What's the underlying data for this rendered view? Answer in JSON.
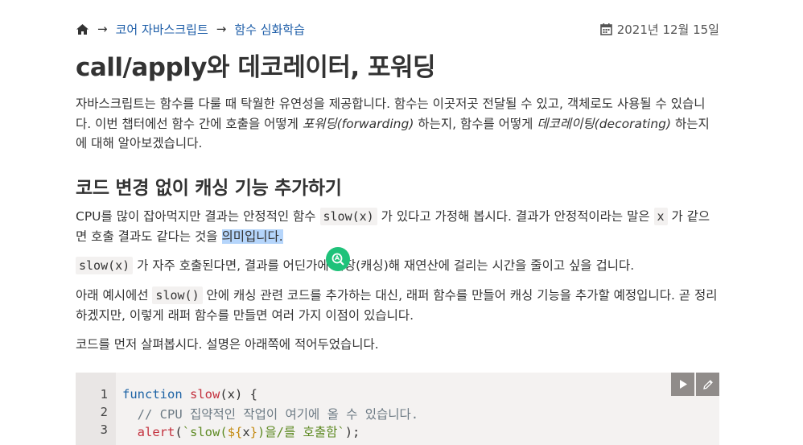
{
  "breadcrumb": {
    "items": [
      "코어 자바스크립트",
      "함수 심화학습"
    ],
    "separator": "→"
  },
  "date": "2021년 12월 15일",
  "title": "call/apply와 데코레이터, 포워딩",
  "intro": {
    "a": "자바스크립트는 함수를 다룰 때 탁월한 유연성을 제공합니다. 함수는 이곳저곳 전달될 수 있고, 객체로도 사용될 수 있습니다. 이번 챕터에선 함수 간에 호출을 어떻게 ",
    "em1": "포워딩(forwarding)",
    "b": " 하는지, 함수를 어떻게 ",
    "em2": "데코레이팅(decorating)",
    "c": " 하는지에 대해 알아보겠습니다."
  },
  "section_heading": "코드 변경 없이 캐싱 기능 추가하기",
  "p2": {
    "a": "CPU를 많이 잡아먹지만 결과는 안정적인 함수 ",
    "code1": "slow(x)",
    "b": " 가 있다고 가정해 봅시다. 결과가 안정적이라는 말은 ",
    "code2": "x",
    "c": " 가 같으면 호출 결과도 같다는 것을 ",
    "highlight": "의미입니다."
  },
  "p3": {
    "code": "slow(x)",
    "a": " 가 자주 호출된다면, 결과를 어딘가에 저장(캐싱)해 재연산에 걸리는 시간을 줄이고 싶을 겁니다."
  },
  "p4": {
    "a": "아래 예시에선 ",
    "code": "slow()",
    "b": " 안에 캐싱 관련 코드를 추가하는 대신, 래퍼 함수를 만들어 캐싱 기능을 추가할 예정입니다. 곧 정리하겠지만, 이렇게 래퍼 함수를 만들면 여러 가지 이점이 있습니다."
  },
  "p5": "코드를 먼저 살펴봅시다. 설명은 아래쪽에 적어두었습니다.",
  "code_block": {
    "line_numbers": [
      "1",
      "2",
      "3"
    ],
    "line1": {
      "kw": "function",
      "fn": "slow",
      "rest": "(x) {"
    },
    "line2": {
      "comment": "  // CPU 집약적인 작업이 여기에 올 수 있습니다."
    },
    "line3": {
      "indent": "  ",
      "fn": "alert",
      "open": "(",
      "str1": "`slow(",
      "tpl_open": "${",
      "var": "x",
      "tpl_close": "}",
      "str2": ")을/를 호출함`",
      "close": ");"
    }
  },
  "icons": [
    "home-icon",
    "arrow-right-icon",
    "calendar-icon",
    "translate-badge-icon",
    "play-icon",
    "edit-icon"
  ],
  "colors": {
    "link": "#1e5ea8",
    "badge": "#1fc27a",
    "selection": "#b5d5fb",
    "code_bg": "#f4f2f1"
  }
}
